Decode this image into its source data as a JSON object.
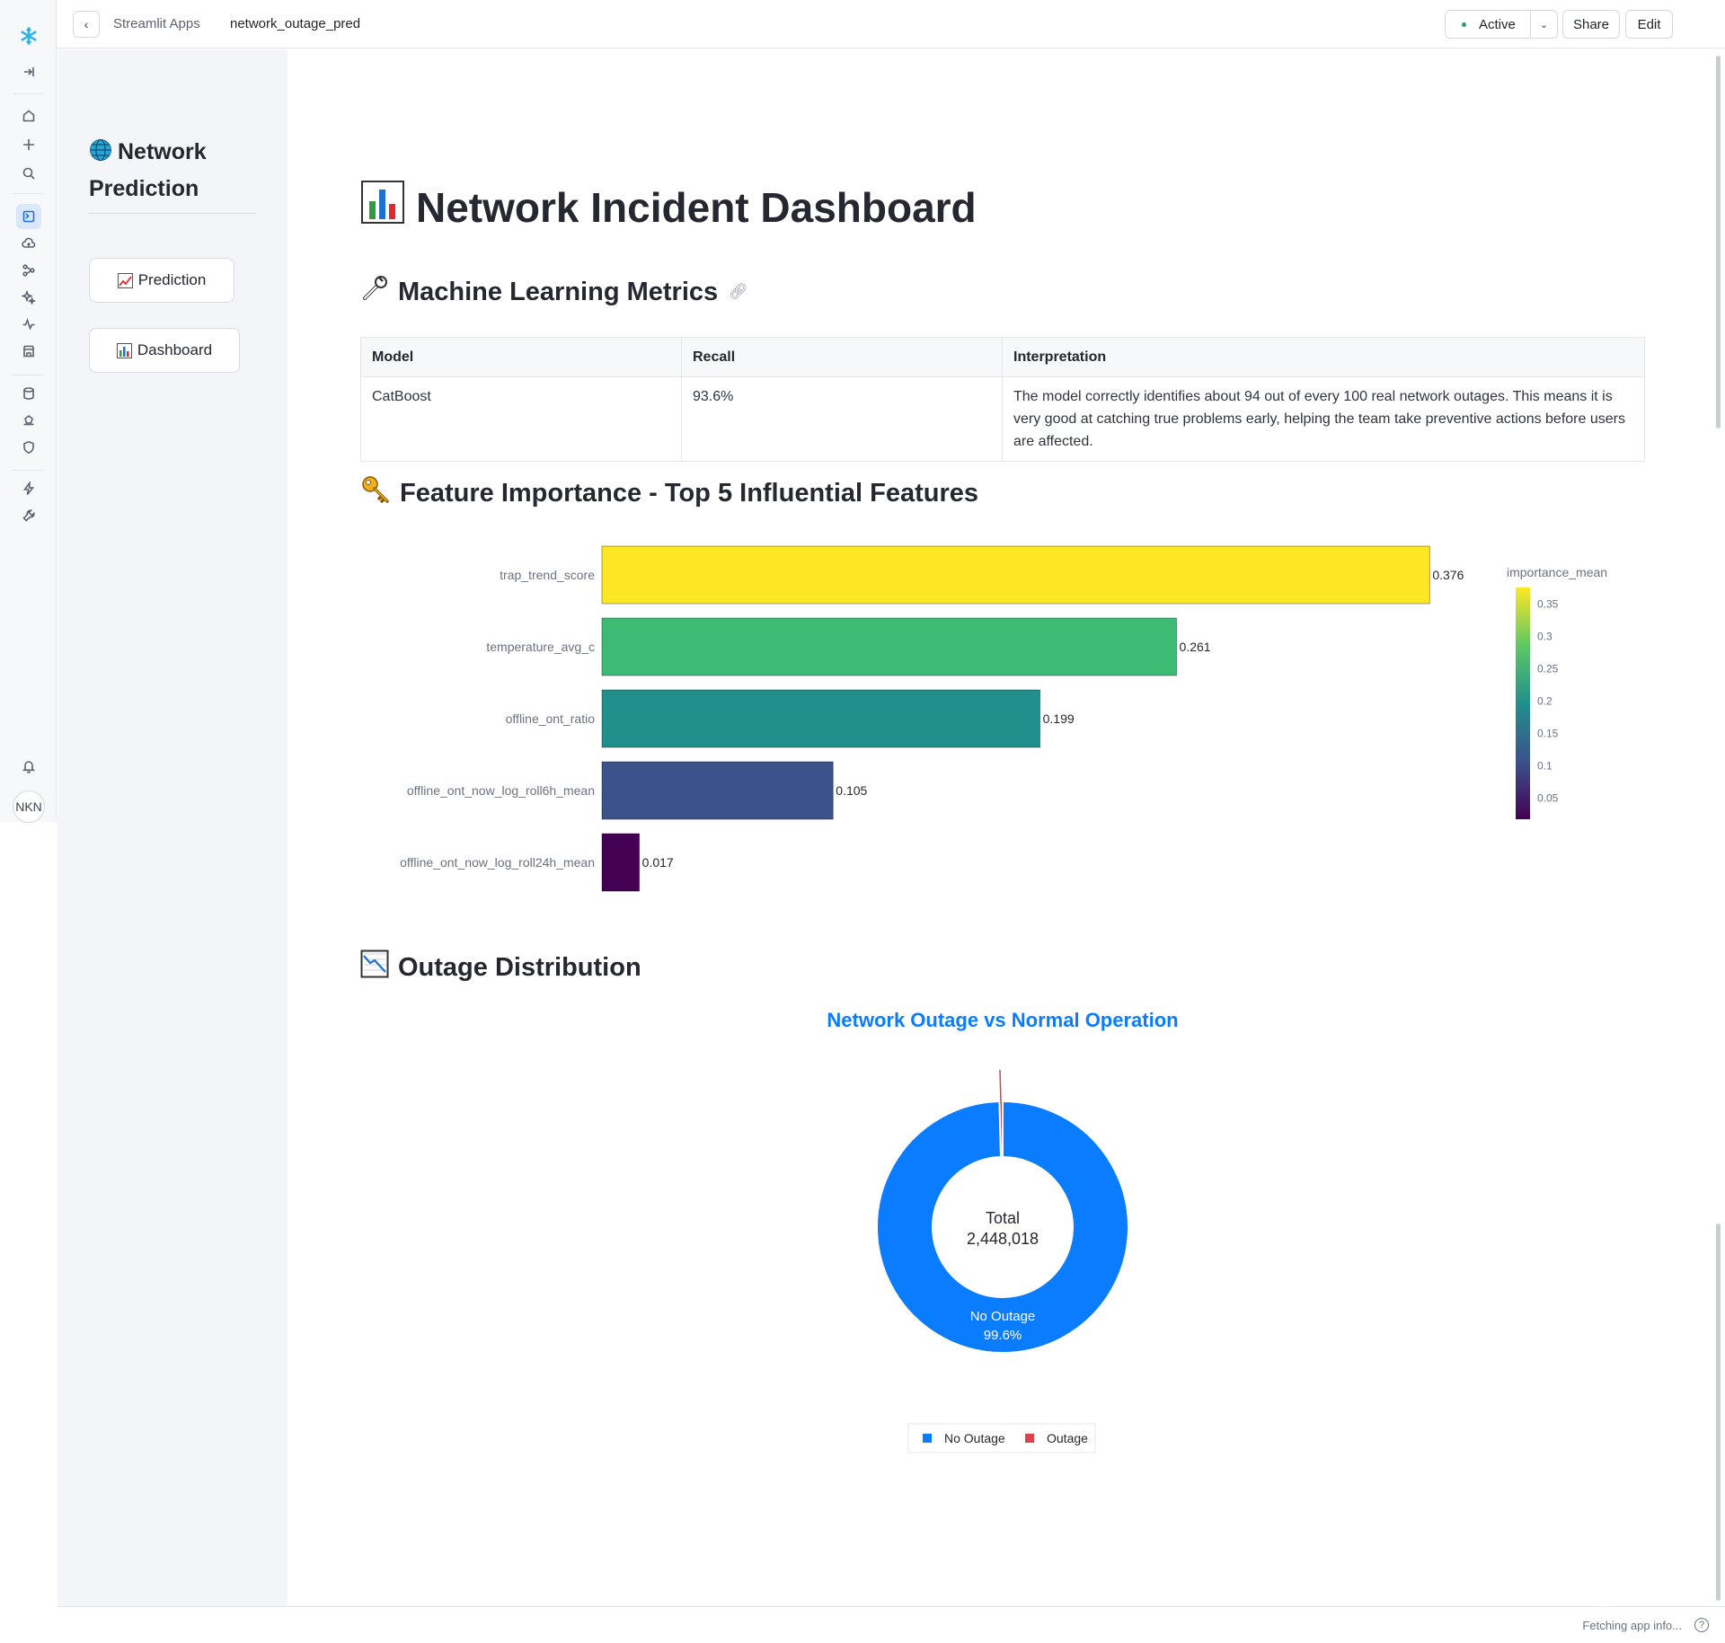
{
  "topbar": {
    "breadcrumb_parent": "Streamlit Apps",
    "breadcrumb_current": "network_outage_pred",
    "status_label": "Active",
    "share_label": "Share",
    "edit_label": "Edit"
  },
  "rail": {
    "avatar_initials": "NKN"
  },
  "sidebar": {
    "title": "Network Prediction",
    "buttons": [
      {
        "label": "Prediction",
        "icon": "chart-increasing-icon"
      },
      {
        "label": "Dashboard",
        "icon": "bar-chart-icon"
      }
    ]
  },
  "main": {
    "title": "Network Incident Dashboard",
    "metrics_heading": "Machine Learning Metrics",
    "metrics_table": {
      "headers": [
        "Model",
        "Recall",
        "Interpretation"
      ],
      "rows": [
        [
          "CatBoost",
          "93.6%",
          "The model correctly identifies about 94 out of every 100 real network outages. This means it is very good at catching true problems early, helping the team take preventive actions before users are affected."
        ]
      ]
    },
    "feature_heading": "Feature Importance - Top 5 Influential Features",
    "outage_heading": "Outage Distribution"
  },
  "chart_data": [
    {
      "type": "bar",
      "orientation": "horizontal",
      "categories": [
        "trap_trend_score",
        "temperature_avg_c",
        "offline_ont_ratio",
        "offline_ont_now_log_roll6h_mean",
        "offline_ont_now_log_roll24h_mean"
      ],
      "values": [
        0.376,
        0.261,
        0.199,
        0.105,
        0.017
      ],
      "value_labels": [
        "0.376",
        "0.261",
        "0.199",
        "0.105",
        "0.017"
      ],
      "colors": [
        "#fde725",
        "#3dbb74",
        "#21908d",
        "#3b528b",
        "#440154"
      ],
      "colorbar": {
        "title": "importance_mean",
        "ticks": [
          "0.35",
          "0.3",
          "0.25",
          "0.2",
          "0.15",
          "0.1",
          "0.05"
        ],
        "range": [
          0.017,
          0.376
        ]
      },
      "xlim": [
        0,
        0.4
      ]
    },
    {
      "type": "pie",
      "hole": true,
      "title": "Network Outage vs Normal Operation",
      "center_label": "Total",
      "center_value": "2,448,018",
      "categories": [
        "No Outage",
        "Outage"
      ],
      "values": [
        99.6,
        0.4
      ],
      "slice_labels": [
        "No Outage",
        "99.6%"
      ],
      "colors": [
        "#0a7cff",
        "#e0404b"
      ],
      "legend": [
        "No Outage",
        "Outage"
      ]
    }
  ]
}
